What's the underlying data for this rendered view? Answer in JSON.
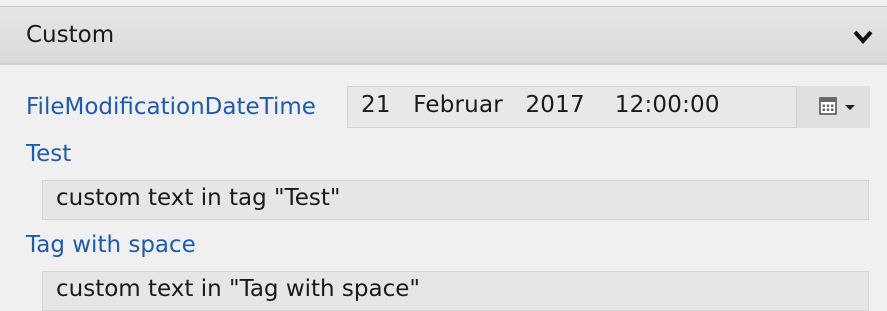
{
  "group": {
    "title": "Custom",
    "toggle_icon": "chevron-down-icon"
  },
  "properties": [
    {
      "label": "FileModificationDateTime",
      "value": "21   Februar   2017    12:00:00",
      "picker_icon": "calendar-icon",
      "dropdown_icon": "chevron-down-icon"
    },
    {
      "label": "Test",
      "value": "custom text in tag \"Test\""
    },
    {
      "label": "Tag with space",
      "value": "custom text in \"Tag with space\""
    }
  ],
  "colors": {
    "label": "#1f5ba8",
    "text": "#1a1a1a",
    "header_bg": "#dedede",
    "field_bg": "#e6e6e6"
  }
}
